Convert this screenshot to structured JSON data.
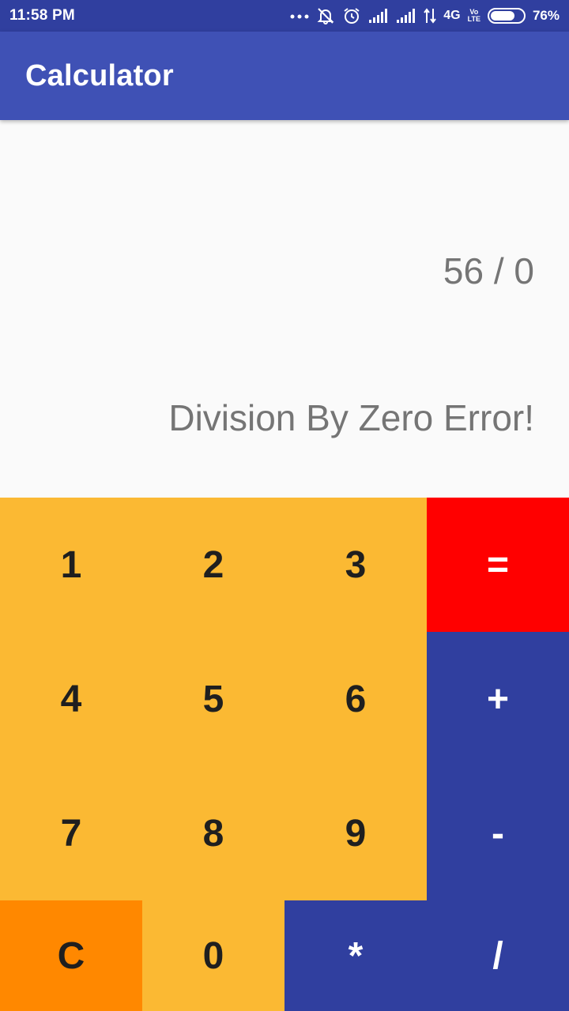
{
  "status_bar": {
    "time": "11:58 PM",
    "more_dots": "...",
    "network": "4G",
    "volte": [
      "Vo",
      "LTE"
    ],
    "battery_percent": "76%",
    "battery_level": 0.76,
    "icons": [
      "more-icon",
      "notifications-off-icon",
      "alarm-icon",
      "signal-icon",
      "signal-icon",
      "data-transfer-icon",
      "battery-icon"
    ]
  },
  "app_bar": {
    "title": "Calculator"
  },
  "display": {
    "expression": "56 / 0",
    "result": "Division By Zero Error!"
  },
  "keypad": {
    "k1": "1",
    "k2": "2",
    "k3": "3",
    "k4": "4",
    "k5": "5",
    "k6": "6",
    "k7": "7",
    "k8": "8",
    "k9": "9",
    "k0": "0",
    "clear": "C",
    "equals": "=",
    "plus": "+",
    "minus": "-",
    "multiply": "*",
    "divide": "/"
  },
  "colors": {
    "status_bar": "#303f9f",
    "app_bar": "#3f51b5",
    "digit_key": "#fbb933",
    "clear_key": "#ff8800",
    "equals_key": "#ff0000",
    "operator_key": "#303f9f",
    "display_text": "#757575"
  }
}
